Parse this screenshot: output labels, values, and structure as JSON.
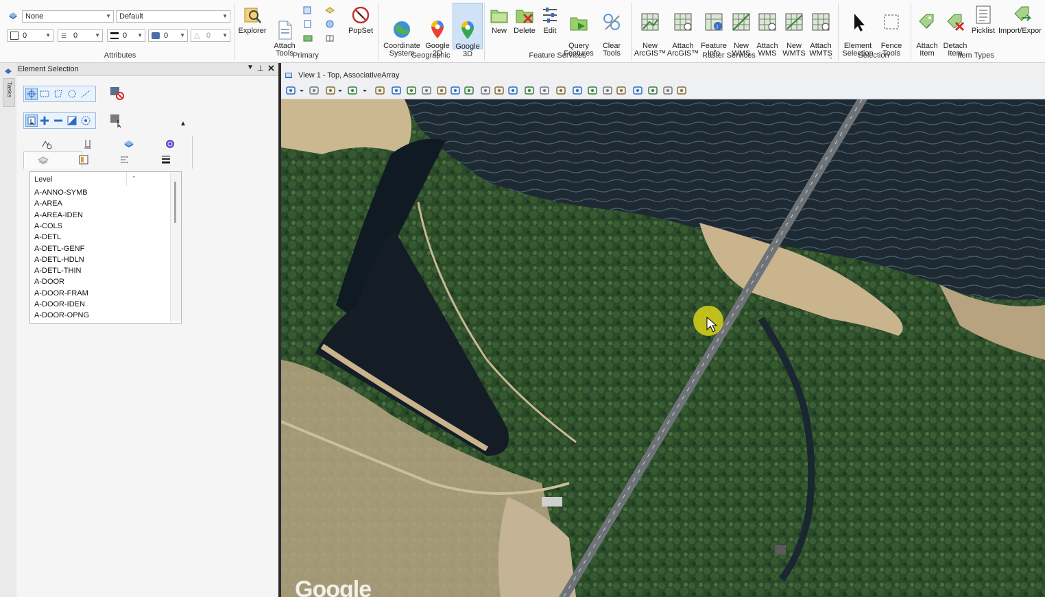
{
  "ribbon": {
    "attributes": {
      "level_value": "None",
      "style_value": "Default",
      "color_value": "0",
      "linestyle_value": "0",
      "weight_value": "0",
      "transparency_value": "0",
      "priority_value": "0",
      "group_label": "Attributes"
    },
    "primary": {
      "explorer": "Explorer",
      "attach_tools": "Attach\nTools",
      "popset": "PopSet",
      "group_label": "Primary"
    },
    "geographic": {
      "coordinate_system": "Coordinate\nSystem",
      "google_2d": "Google\n2D",
      "google_3d": "Google\n3D",
      "group_label": "Geographic"
    },
    "feature_services": {
      "new": "New",
      "delete": "Delete",
      "edit": "Edit",
      "query_features": "Query\nFeatures",
      "clear_tools": "Clear\nTools",
      "group_label": "Feature Services"
    },
    "raster_services": {
      "new_arcgis": "New\nArcGIS™",
      "attach_arcgis": "Attach\nArcGIS™",
      "feature_info": "Feature\nInfo",
      "new_wms": "New\nWMS",
      "attach_wms": "Attach\nWMS",
      "new_wmts": "New\nWMTS",
      "attach_wmts": "Attach\nWMTS",
      "group_label": "Raster Services"
    },
    "selection": {
      "element_selection": "Element\nSelection",
      "fence_tools": "Fence\nTools",
      "group_label": "Selection"
    },
    "item_types": {
      "attach_item": "Attach\nItem",
      "detach_item": "Detach\nItem",
      "picklist": "Picklist",
      "import_export": "Import/Expor",
      "group_label": "Item Types"
    }
  },
  "side_tabs": {
    "tasks": "Tasks"
  },
  "panel": {
    "title": "Element Selection",
    "level_header": "Level",
    "levels": [
      "A-ANNO-SYMB",
      "A-AREA",
      "A-AREA-IDEN",
      "A-COLS",
      "A-DETL",
      "A-DETL-GENF",
      "A-DETL-HDLN",
      "A-DETL-THIN",
      "A-DOOR",
      "A-DOOR-FRAM",
      "A-DOOR-IDEN",
      "A-DOOR-OPNG"
    ]
  },
  "view": {
    "title": "View 1 - Top, AssociativeArray",
    "map_watermark": "Google"
  },
  "colors": {
    "accent": "#2b6cc4",
    "cursor_highlight": "#d9d21a"
  }
}
